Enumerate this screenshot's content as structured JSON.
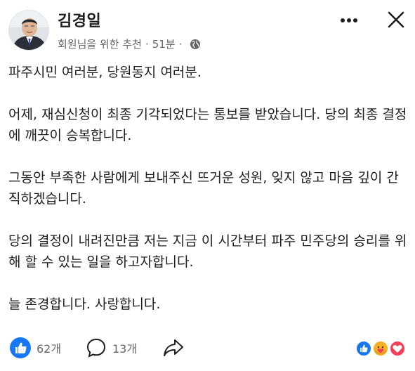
{
  "post": {
    "author": "김경일",
    "meta_label": "회원님을 위한 추천",
    "separator": "·",
    "time": "51분",
    "privacy_icon": "globe-icon"
  },
  "header_actions": {
    "more_icon": "more-icon",
    "close_icon": "close-icon"
  },
  "body": {
    "paragraphs": [
      "파주시민 여러분, 당원동지 여러분.",
      "어제, 재심신청이 최종 기각되었다는 통보를 받았습니다. 당의 최종 결정에 깨끗이 승복합니다.",
      "그동안 부족한 사람에게 보내주신 뜨거운 성원, 잊지 않고 마음 깊이 간직하겠습니다.",
      "당의 결정이 내려진만큼 저는 지금 이 시간부터 파주 민주당의 승리를 위해 할 수 있는 일을 하고자합니다.",
      "늘 존경합니다. 사랑합니다."
    ]
  },
  "footer": {
    "likes": "62개",
    "comments": "13개",
    "like_icon": "like-icon",
    "comment_icon": "comment-icon",
    "share_icon": "share-icon",
    "reactions": [
      "like",
      "care",
      "love"
    ]
  },
  "colors": {
    "text": "#1c1e21",
    "secondary": "#65676b",
    "brand_blue": "#1877f2",
    "love_red": "#f33e58",
    "care_yellow": "#f7b125"
  }
}
